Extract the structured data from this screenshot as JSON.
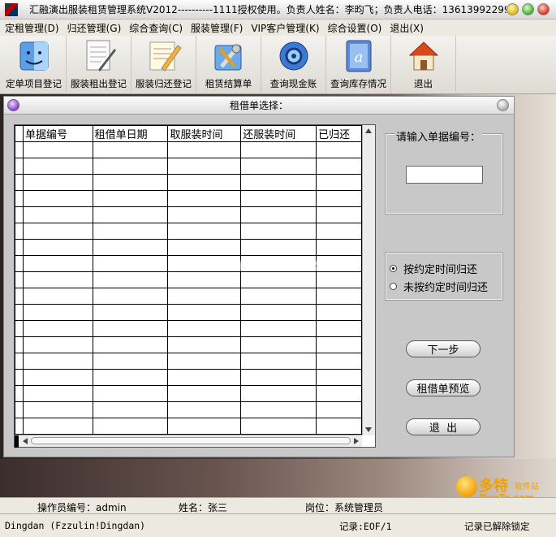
{
  "window": {
    "title": "汇融演出服装租赁管理系统V2012----------1111授权使用。负责人姓名：李昀飞；负责人电话：13613992299。"
  },
  "menu": [
    "定租管理(D)",
    "归还管理(G)",
    "综合查询(C)",
    "服装管理(F)",
    "VIP客户管理(K)",
    "综合设置(O)",
    "退出(X)"
  ],
  "toolbar": [
    {
      "label": "定单项目登记",
      "icon": "finder-face-icon"
    },
    {
      "label": "服装租出登记",
      "icon": "document-pen-icon"
    },
    {
      "label": "服装归还登记",
      "icon": "note-pencil-icon"
    },
    {
      "label": "租赁结算单",
      "icon": "tools-icon"
    },
    {
      "label": "查询现金账",
      "icon": "gear-globe-icon"
    },
    {
      "label": "查询库存情况",
      "icon": "address-book-icon"
    },
    {
      "label": "退出",
      "icon": "home-icon"
    }
  ],
  "dialog": {
    "title": "租借单选择：",
    "grid": {
      "columns": [
        "单据编号",
        "租借单日期",
        "取服装时间",
        "还服装时间",
        "已归还"
      ],
      "row_count": 18
    },
    "input_group": {
      "label": "请输入单据编号：",
      "value": ""
    },
    "radios": [
      {
        "label": "按约定时间归还",
        "checked": true
      },
      {
        "label": "未按约定时间归还",
        "checked": false
      }
    ],
    "buttons": {
      "next": "下一步",
      "preview": "租借单预览",
      "exit": "退  出"
    }
  },
  "watermark": "www.DuoTe.com",
  "info_bar": {
    "operator": "操作员编号：admin",
    "name": "姓名：张三",
    "position": "岗位：系统管理员"
  },
  "status_bar": {
    "left": "Dingdan (Fzzulin!Dingdan)",
    "record": "记录:EOF/1",
    "lock": "记录已解除锁定"
  },
  "logo": {
    "brand": "多特",
    "sub": "软件站",
    "url": "DuoTe.com"
  },
  "colors": {
    "window_bg": "#d4d0c8",
    "dialog_bg": "#c8c8c8",
    "logo_accent": "#f2a000"
  }
}
